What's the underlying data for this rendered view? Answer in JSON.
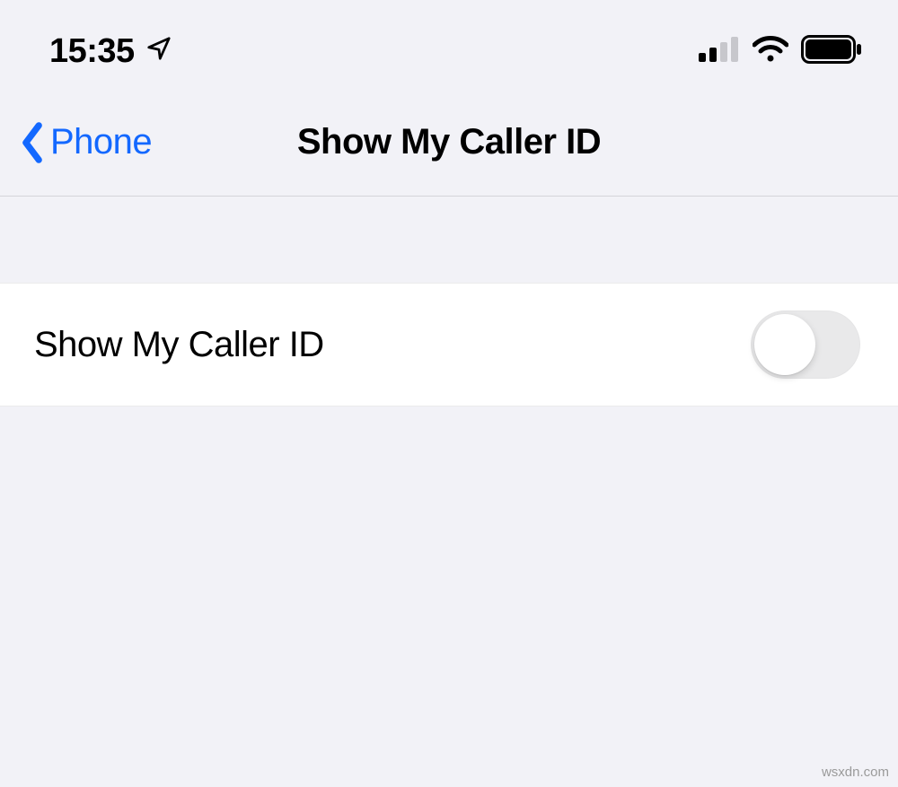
{
  "status_bar": {
    "time": "15:35",
    "location_icon": "location-arrow",
    "signal_bars_active": 2,
    "signal_bars_total": 4,
    "wifi_strength": 3,
    "battery_level_pct": 95
  },
  "nav": {
    "back_label": "Phone",
    "title": "Show My Caller ID"
  },
  "settings": {
    "caller_id": {
      "label": "Show My Caller ID",
      "enabled": false
    }
  },
  "watermark": "wsxdn.com"
}
